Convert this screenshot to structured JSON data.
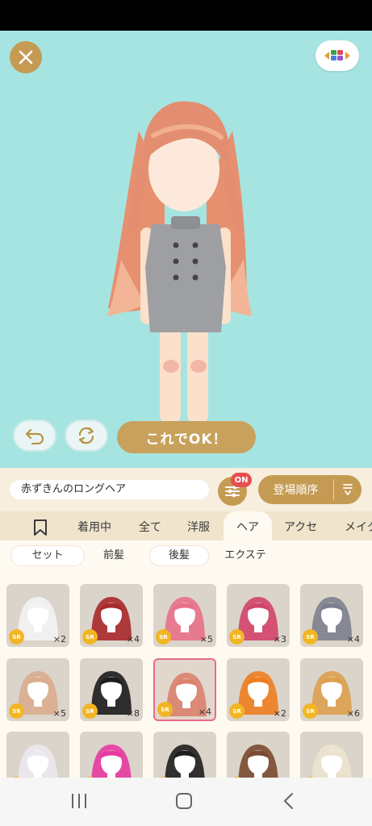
{
  "stage": {
    "ok_label": "これでOK！",
    "background": "#a6e4e1"
  },
  "name_row": {
    "item_name": "赤ずきんのロングヘア",
    "on_badge": "ON",
    "sort_label": "登場順序"
  },
  "tabs": {
    "items": [
      "着用中",
      "全て",
      "洋服",
      "ヘア",
      "アクセ",
      "メイク"
    ],
    "active": "ヘア"
  },
  "subtabs": {
    "items": [
      "セット",
      "前髪",
      "後髪",
      "エクステ"
    ]
  },
  "grid": {
    "rarity_label": "SR",
    "rows": [
      [
        {
          "count": "×2",
          "hair": "#f3f3f5"
        },
        {
          "count": "×4",
          "hair": "#a8282b"
        },
        {
          "count": "×5",
          "hair": "#e7718a"
        },
        {
          "count": "×3",
          "hair": "#d2446a"
        },
        {
          "count": "×4",
          "hair": "#7c7f8e"
        }
      ],
      [
        {
          "count": "×5",
          "hair": "#d9ad8e"
        },
        {
          "count": "×8",
          "hair": "#1c1c1c"
        },
        {
          "count": "×4",
          "hair": "#d9826d"
        },
        {
          "count": "×2",
          "hair": "#ee7d1f"
        },
        {
          "count": "×6",
          "hair": "#dca04f"
        }
      ],
      [
        {
          "count": "",
          "hair": "#ece8ee"
        },
        {
          "count": "",
          "hair": "#e63aa0"
        },
        {
          "count": "",
          "hair": "#1e1e1e"
        },
        {
          "count": "",
          "hair": "#7a4a30"
        },
        {
          "count": "",
          "hair": "#ece3cf"
        }
      ]
    ]
  },
  "icons": {
    "close": "close-icon",
    "palette": "palette-icon",
    "undo": "undo-icon",
    "rotate": "rotate-icon",
    "filter": "sliders-icon",
    "sort": "sort-order-icon",
    "bookmark": "bookmark-icon",
    "nav_recents": "recents-icon",
    "nav_home": "home-icon",
    "nav_back": "back-icon"
  },
  "colors": {
    "gold": "#c59a52",
    "badge_red": "#e84f4f",
    "selected_border": "#e86b84"
  }
}
